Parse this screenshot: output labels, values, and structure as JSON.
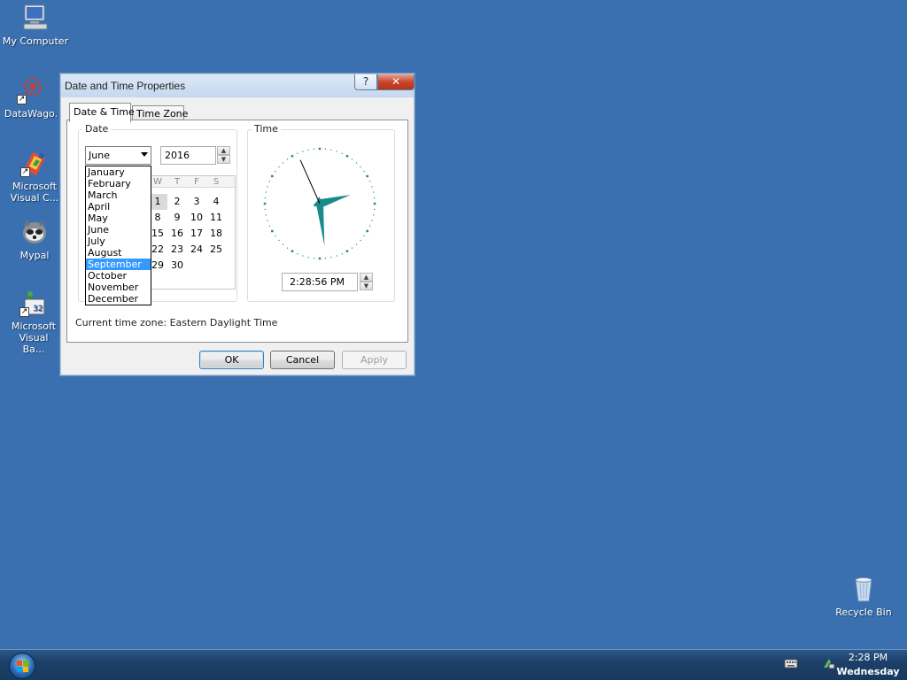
{
  "desktop": {
    "icons": [
      {
        "label": "My Computer",
        "icon": "computer-icon"
      },
      {
        "label": "DataWago.",
        "icon": "datawago-icon"
      },
      {
        "label": "Microsoft Visual C...",
        "icon": "visual-c-icon"
      },
      {
        "label": "Mypal",
        "icon": "mypal-icon"
      },
      {
        "label": "Microsoft Visual Ba...",
        "icon": "visual-basic-icon"
      },
      {
        "label": "Recycle Bin",
        "icon": "recycle-bin-icon"
      }
    ]
  },
  "dialog": {
    "title": "Date and Time Properties",
    "help_glyph": "?",
    "close_glyph": "✕",
    "tabs": [
      {
        "label": "Date & Time",
        "active": true
      },
      {
        "label": "Time Zone",
        "active": false
      }
    ],
    "date_group": {
      "title": "Date",
      "month": "June",
      "year": "2016",
      "calendar": {
        "day_headers": [
          "W",
          "T",
          "F",
          "S"
        ],
        "rows": [
          [
            "1",
            "2",
            "3",
            "4"
          ],
          [
            "8",
            "9",
            "10",
            "11"
          ],
          [
            "15",
            "16",
            "17",
            "18"
          ],
          [
            "22",
            "23",
            "24",
            "25"
          ],
          [
            "29",
            "30",
            "",
            ""
          ]
        ],
        "selected": "1"
      },
      "month_dropdown": {
        "options": [
          "January",
          "February",
          "March",
          "April",
          "May",
          "June",
          "July",
          "August",
          "September",
          "October",
          "November",
          "December"
        ],
        "highlighted": "September"
      }
    },
    "time_group": {
      "title": "Time",
      "time_value": "2:28:56 PM",
      "clock": {
        "hour": 2,
        "minute": 28,
        "second": 56
      },
      "clock_color": "#1a8a8a"
    },
    "timezone_line": "Current time zone:  Eastern Daylight Time",
    "buttons": {
      "ok": "OK",
      "cancel": "Cancel",
      "apply": "Apply"
    }
  },
  "taskbar": {
    "time": "2:28 PM",
    "day": "Wednesday",
    "tray_icons": [
      "keyboard-icon",
      "network-icon"
    ]
  },
  "colors": {
    "desktop": "#3a70b0",
    "highlight": "#3399ff",
    "taskbar": "#1c3f68"
  }
}
